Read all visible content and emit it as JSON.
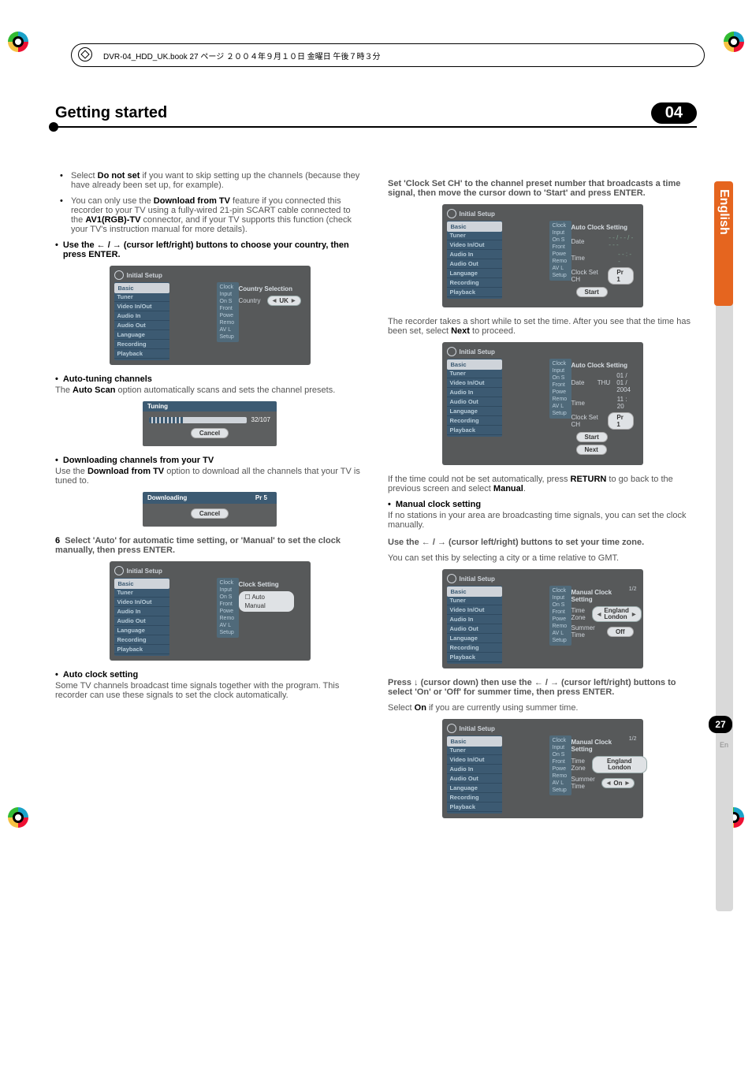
{
  "print_header": "DVR-04_HDD_UK.book 27 ページ ２００４年９月１０日 金曜日 午後７時３分",
  "title": "Getting started",
  "chapter": "04",
  "side_tab": "English",
  "page_number": "27",
  "page_lang_short": "En",
  "left": {
    "bullet1_a": "Select ",
    "bullet1_b": "Do not set",
    "bullet1_c": " if you want to skip setting up the channels (because they have already been set up, for example).",
    "bullet2_a": "You can only use the ",
    "bullet2_b": "Download from TV",
    "bullet2_c": " feature if you connected this recorder to your TV using a fully-wired 21-pin SCART cable connected to the ",
    "bullet2_d": "AV1(RGB)-TV",
    "bullet2_e": " connector, and if your TV supports this function (check your TV's instruction manual for more details).",
    "step_use_lr": "Use the ← / → (cursor left/right) buttons to choose your country, then press ENTER.",
    "osd1": {
      "title": "Initial Setup",
      "heading": "Country Selection",
      "field": "Country",
      "value": "UK"
    },
    "auto_tune_head": "Auto-tuning channels",
    "auto_tune_body_a": "The ",
    "auto_tune_body_b": "Auto Scan",
    "auto_tune_body_c": " option automatically scans and sets the channel presets.",
    "tuning_title": "Tuning",
    "tuning_count": "32/107",
    "cancel": "Cancel",
    "dl_head": "Downloading channels from your TV",
    "dl_body_a": "Use the ",
    "dl_body_b": "Download from TV",
    "dl_body_c": " option to download all the channels that your TV is tuned to.",
    "dl_title": "Downloading",
    "dl_pr": "Pr 5",
    "step6_num": "6",
    "step6": "Select 'Auto' for automatic time setting, or 'Manual' to set the clock manually, then press ENTER.",
    "osd2": {
      "title": "Initial Setup",
      "heading": "Clock Setting",
      "opt1": "Auto",
      "opt2": "Manual"
    },
    "autoclock_head": "Auto clock setting",
    "autoclock_body": "Some TV channels broadcast time signals together with the program. This recorder can use these signals to set the clock automatically."
  },
  "menu": {
    "items": [
      "Basic",
      "Tuner",
      "Video In/Out",
      "Audio In",
      "Audio Out",
      "Language",
      "Recording",
      "Playback"
    ],
    "sub": [
      "Clock",
      "Input",
      "On S",
      "Front",
      "Powe",
      "Remo",
      "AV L",
      "Setup"
    ]
  },
  "right": {
    "setch_head": "Set 'Clock Set CH' to the channel preset number that broadcasts a time signal, then move the cursor down to 'Start' and press ENTER.",
    "osd3": {
      "title": "Initial Setup",
      "heading": "Auto Clock Setting",
      "date_lbl": "Date",
      "date_val": "- - / - - / - - - -",
      "time_lbl": "Time",
      "time_val": "- - : - -",
      "ch_lbl": "Clock Set CH",
      "ch_val": "Pr 1",
      "start": "Start"
    },
    "rec_wait": "The recorder takes a short while to set the time. After you see that the time has been set, select ",
    "rec_wait_b": "Next",
    "rec_wait_c": " to proceed.",
    "osd4": {
      "title": "Initial Setup",
      "heading": "Auto Clock Setting",
      "date_lbl": "Date",
      "date_day": "THU",
      "date_val": "01 / 01 / 2004",
      "time_lbl": "Time",
      "time_val": "11 : 20",
      "ch_lbl": "Clock Set CH",
      "ch_val": "Pr 1",
      "start": "Start",
      "next": "Next"
    },
    "ifnot_a": "If the time could not be set automatically, press ",
    "ifnot_b": "RETURN",
    "ifnot_c": " to go back to the previous screen and select ",
    "ifnot_d": "Manual",
    "ifnot_e": ".",
    "manual_head": "Manual clock setting",
    "manual_body": "If no stations in your area are broadcasting time signals, you can set the clock manually.",
    "tz_head": "Use the ← / → (cursor left/right) buttons to set your time zone.",
    "tz_body": "You can set this by selecting a city or a time relative to GMT.",
    "osd5": {
      "title": "Initial Setup",
      "heading": "Manual Clock Setting",
      "page": "1/2",
      "tz_lbl": "Time Zone",
      "tz_val1": "England",
      "tz_val2": "London",
      "st_lbl": "Summer Time",
      "st_val": "Off"
    },
    "summer_head": "Press ↓ (cursor down) then use the ← / → (cursor left/right) buttons to select 'On' or 'Off' for summer time, then press ENTER.",
    "summer_body_a": "Select ",
    "summer_body_b": "On",
    "summer_body_c": " if you are currently using summer time.",
    "osd6": {
      "title": "Initial Setup",
      "heading": "Manual Clock Setting",
      "page": "1/2",
      "tz_lbl": "Time Zone",
      "tz_val1": "England",
      "tz_val2": "London",
      "st_lbl": "Summer Time",
      "st_val": "On"
    }
  }
}
